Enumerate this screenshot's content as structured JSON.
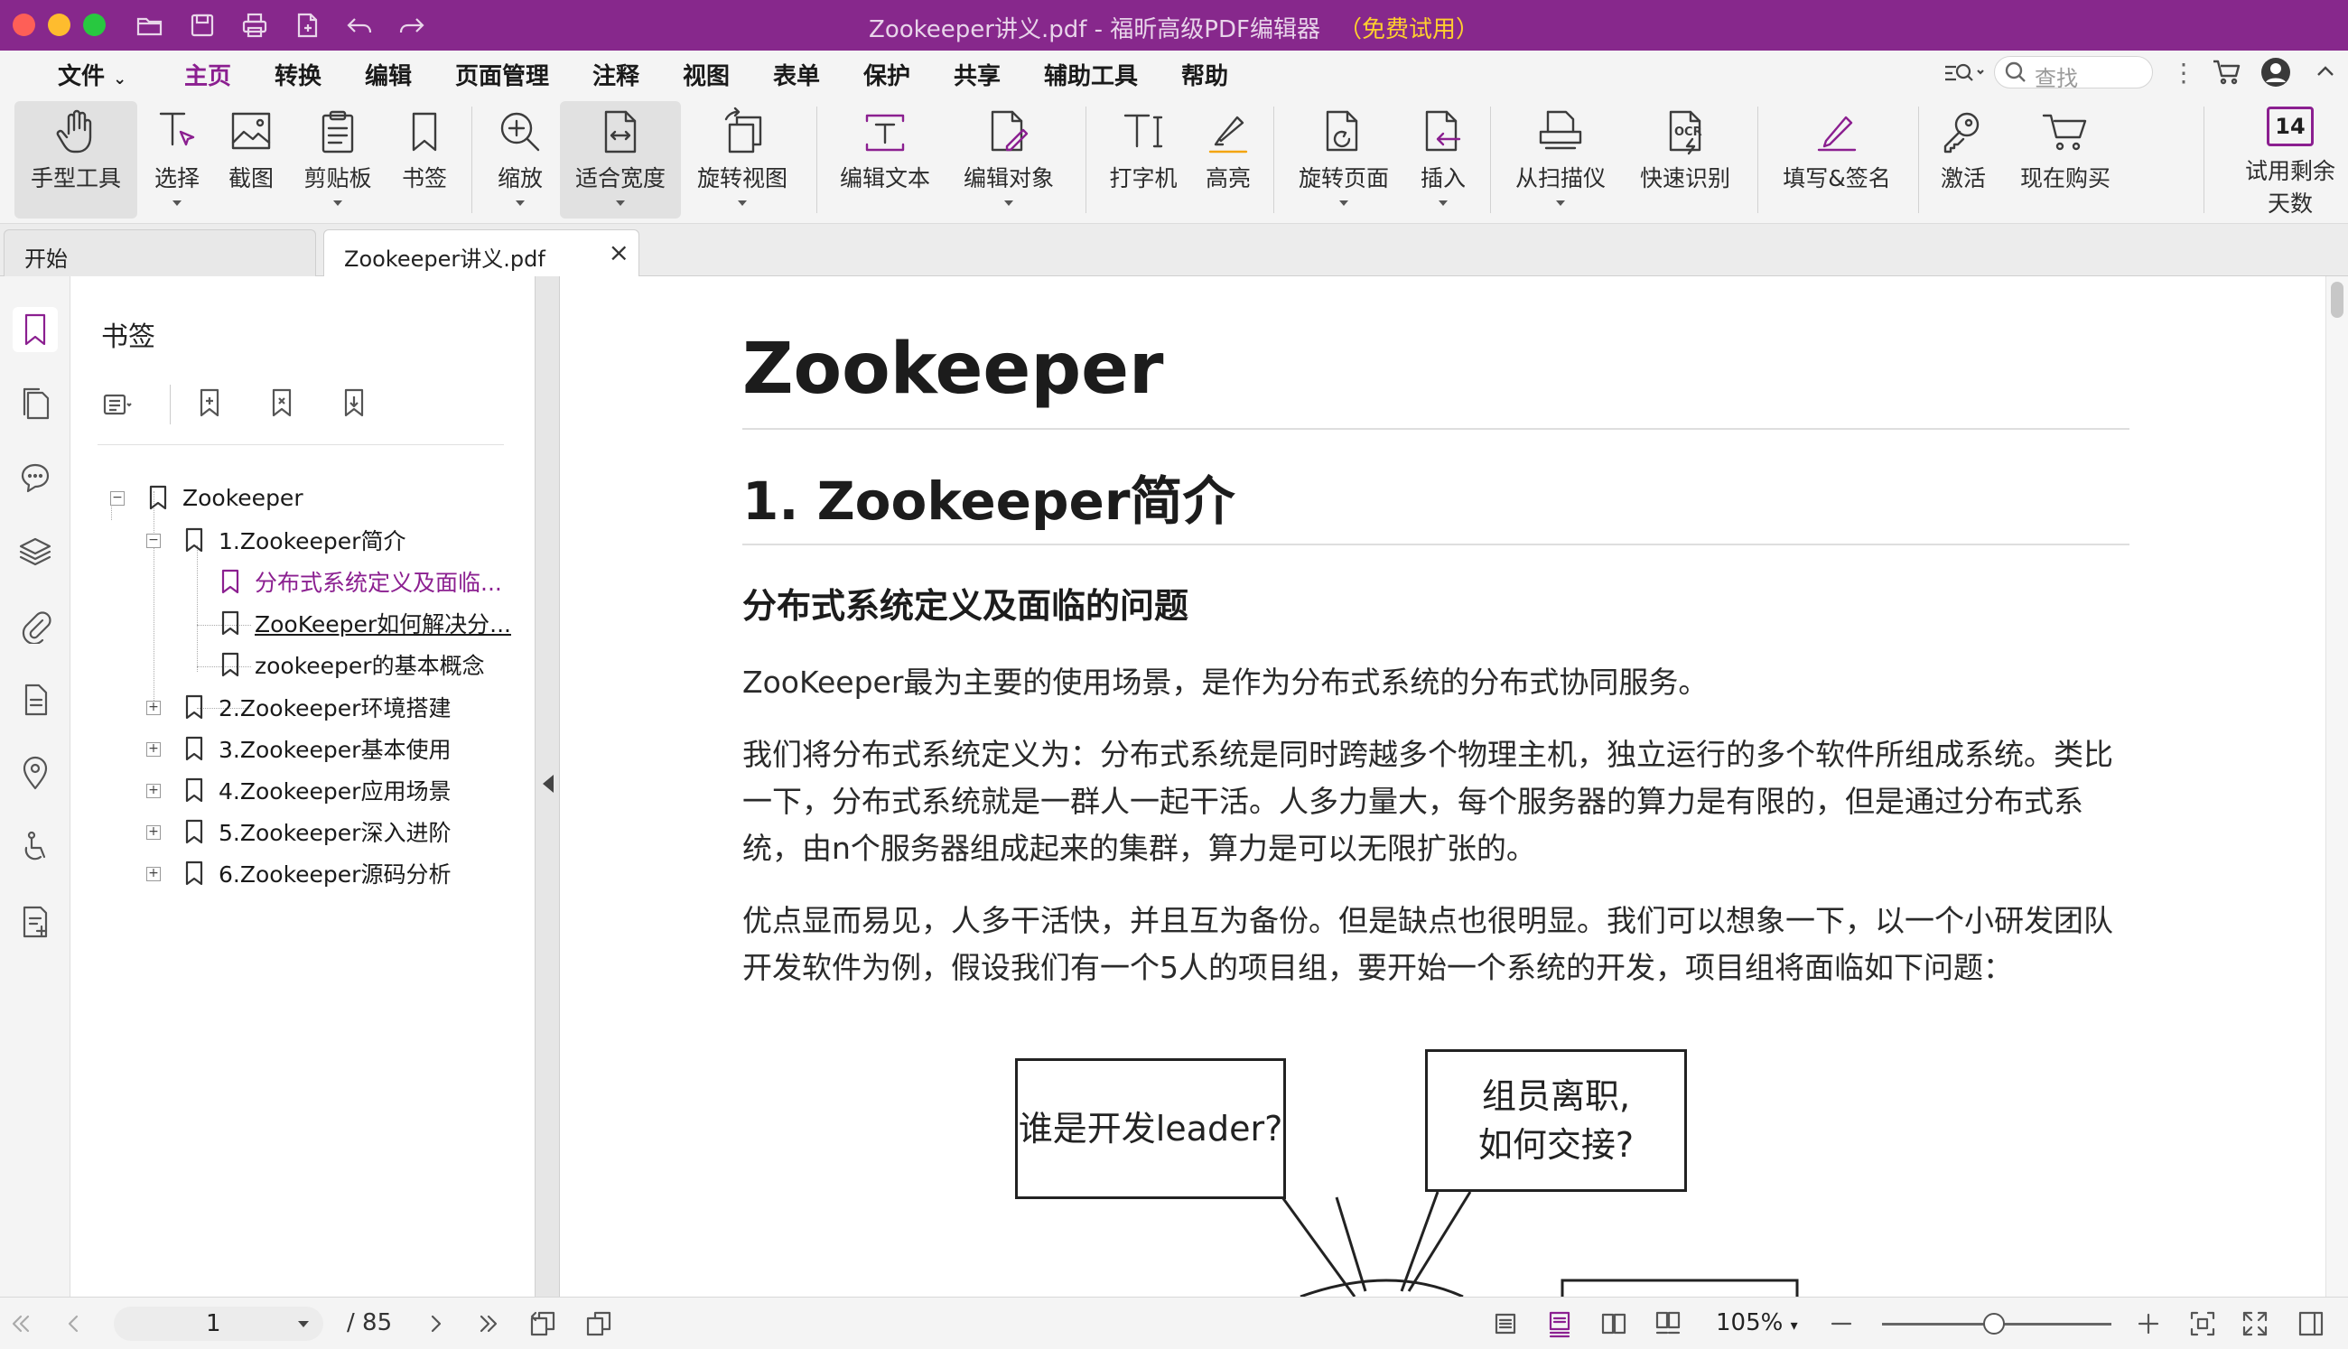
{
  "window": {
    "title": "Zookeeper讲义.pdf - 福昕高级PDF编辑器",
    "trial_tag": "（免费试用）"
  },
  "menu": {
    "file": "文件",
    "items": [
      "主页",
      "转换",
      "编辑",
      "页面管理",
      "注释",
      "视图",
      "表单",
      "保护",
      "共享",
      "辅助工具",
      "帮助"
    ],
    "search_placeholder": "查找"
  },
  "ribbon": {
    "hand": "手型工具",
    "select": "选择",
    "snapshot": "截图",
    "clipboard": "剪贴板",
    "bookmark": "书签",
    "zoom": "缩放",
    "fit_width": "适合宽度",
    "rotate_view": "旋转视图",
    "edit_text": "编辑文本",
    "edit_object": "编辑对象",
    "typewriter": "打字机",
    "highlight": "高亮",
    "rotate_page": "旋转页面",
    "insert": "插入",
    "from_scanner": "从扫描仪",
    "quick_ocr": "快速识别",
    "fill_sign": "填写&签名",
    "activate": "激活",
    "buy_now": "现在购买",
    "trial_days_num": "14",
    "trial_days_label_1": "试用剩余",
    "trial_days_label_2": "天数",
    "icon_text_ocr": "OCR"
  },
  "tabs": {
    "start": "开始",
    "doc": "Zookeeper讲义.pdf"
  },
  "panel": {
    "title": "书签",
    "tree": [
      {
        "label": "Zookeeper"
      },
      {
        "label": "1.Zookeeper简介"
      },
      {
        "label": "分布式系统定义及面临..."
      },
      {
        "label": "ZooKeeper如何解决分..."
      },
      {
        "label": "zookeeper的基本概念"
      },
      {
        "label": "2.Zookeeper环境搭建"
      },
      {
        "label": "3.Zookeeper基本使用"
      },
      {
        "label": "4.Zookeeper应用场景"
      },
      {
        "label": "5.Zookeeper深入进阶"
      },
      {
        "label": "6.Zookeeper源码分析"
      }
    ]
  },
  "doc": {
    "h1": "Zookeeper",
    "h2": "1. Zookeeper简介",
    "h3": "分布式系统定义及面临的问题",
    "p1": "ZooKeeper最为主要的使用场景，是作为分布式系统的分布式协同服务。",
    "p2": "我们将分布式系统定义为：分布式系统是同时跨越多个物理主机，独立运行的多个软件所组成系统。类比一下，分布式系统就是一群人一起干活。人多力量大，每个服务器的算力是有限的，但是通过分布式系统，由n个服务器组成起来的集群，算力是可以无限扩张的。",
    "p3": "优点显而易见，人多干活快，并且互为备份。但是缺点也很明显。我们可以想象一下，以一个小研发团队开发软件为例，假设我们有一个5人的项目组，要开始一个系统的开发，项目组将面临如下问题：",
    "bubble1": "谁是开发leader?",
    "bubble2_l1": "组员离职,",
    "bubble2_l2": "如何交接?"
  },
  "status": {
    "page": "1",
    "total": "/ 85",
    "zoom": "105%"
  },
  "colors": {
    "accent": "#8b1f90",
    "titlebar": "#87288c",
    "trial": "#ffcf2e"
  }
}
